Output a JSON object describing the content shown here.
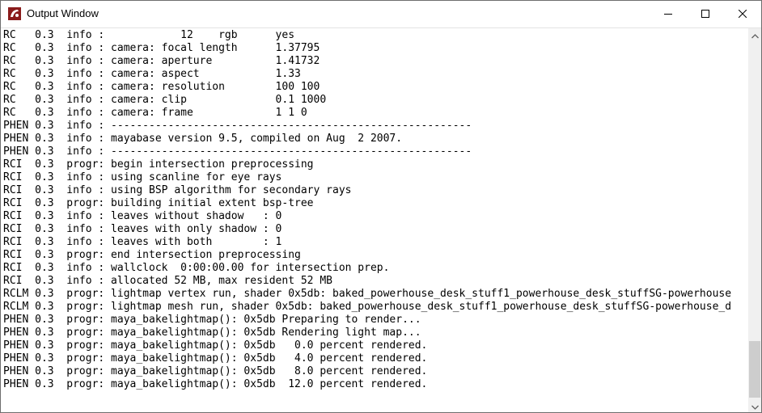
{
  "window": {
    "title": "Output Window",
    "icon": "maya-app-icon",
    "controls": {
      "minimize": "minimize-icon",
      "maximize": "maximize-icon",
      "close": "close-icon"
    }
  },
  "log_lines": [
    "RC   0.3  info :            12    rgb      yes",
    "RC   0.3  info : camera: focal length      1.37795",
    "RC   0.3  info : camera: aperture          1.41732",
    "RC   0.3  info : camera: aspect            1.33",
    "RC   0.3  info : camera: resolution        100 100",
    "RC   0.3  info : camera: clip              0.1 1000",
    "RC   0.3  info : camera: frame             1 1 0",
    "PHEN 0.3  info : ---------------------------------------------------------",
    "PHEN 0.3  info : mayabase version 9.5, compiled on Aug  2 2007.",
    "PHEN 0.3  info : ---------------------------------------------------------",
    "RCI  0.3  progr: begin intersection preprocessing",
    "RCI  0.3  info : using scanline for eye rays",
    "RCI  0.3  info : using BSP algorithm for secondary rays",
    "RCI  0.3  progr: building initial extent bsp-tree",
    "RCI  0.3  info : leaves without shadow   : 0",
    "RCI  0.3  info : leaves with only shadow : 0",
    "RCI  0.3  info : leaves with both        : 1",
    "RCI  0.3  progr: end intersection preprocessing",
    "RCI  0.3  info : wallclock  0:00:00.00 for intersection prep.",
    "RCI  0.3  info : allocated 52 MB, max resident 52 MB",
    "RCLM 0.3  progr: lightmap vertex run, shader 0x5db: baked_powerhouse_desk_stuff1_powerhouse_desk_stuffSG-powerhouse",
    "RCLM 0.3  progr: lightmap mesh run, shader 0x5db: baked_powerhouse_desk_stuff1_powerhouse_desk_stuffSG-powerhouse_d",
    "PHEN 0.3  progr: maya_bakelightmap(): 0x5db Preparing to render...",
    "PHEN 0.3  progr: maya_bakelightmap(): 0x5db Rendering light map...",
    "PHEN 0.3  progr: maya_bakelightmap(): 0x5db   0.0 percent rendered.",
    "PHEN 0.3  progr: maya_bakelightmap(): 0x5db   4.0 percent rendered.",
    "PHEN 0.3  progr: maya_bakelightmap(): 0x5db   8.0 percent rendered.",
    "PHEN 0.3  progr: maya_bakelightmap(): 0x5db  12.0 percent rendered."
  ],
  "scrollbar": {
    "position": 0.85
  }
}
